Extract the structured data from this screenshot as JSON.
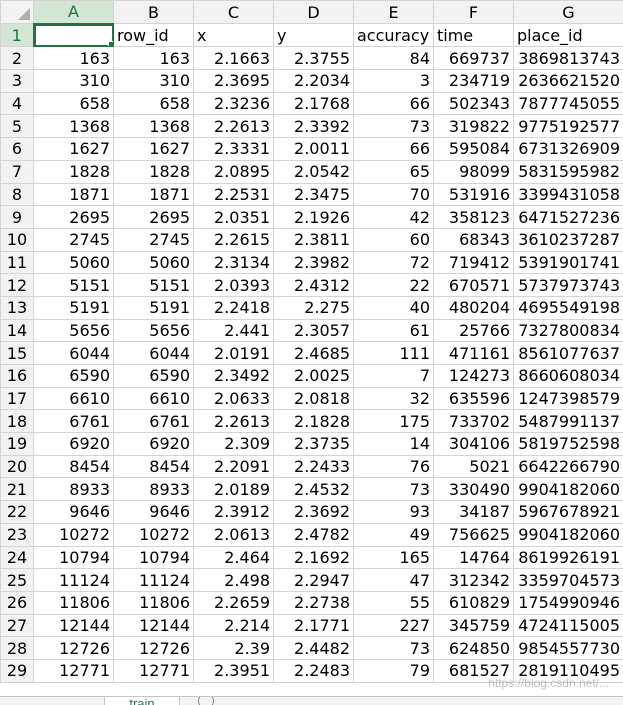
{
  "grid": {
    "columns": [
      "A",
      "B",
      "C",
      "D",
      "E",
      "F",
      "G"
    ],
    "active_column": "A",
    "active_row": "1",
    "headers_row": {
      "row_label": "1",
      "cells": [
        "",
        "row_id",
        "x",
        "y",
        "accuracy",
        "time",
        "place_id"
      ]
    },
    "rows": [
      {
        "label": "2",
        "cells": [
          "163",
          "163",
          "2.1663",
          "2.3755",
          "84",
          "669737",
          "3869813743"
        ]
      },
      {
        "label": "3",
        "cells": [
          "310",
          "310",
          "2.3695",
          "2.2034",
          "3",
          "234719",
          "2636621520"
        ]
      },
      {
        "label": "4",
        "cells": [
          "658",
          "658",
          "2.3236",
          "2.1768",
          "66",
          "502343",
          "7877745055"
        ]
      },
      {
        "label": "5",
        "cells": [
          "1368",
          "1368",
          "2.2613",
          "2.3392",
          "73",
          "319822",
          "9775192577"
        ]
      },
      {
        "label": "6",
        "cells": [
          "1627",
          "1627",
          "2.3331",
          "2.0011",
          "66",
          "595084",
          "6731326909"
        ]
      },
      {
        "label": "7",
        "cells": [
          "1828",
          "1828",
          "2.0895",
          "2.0542",
          "65",
          "98099",
          "5831595982"
        ]
      },
      {
        "label": "8",
        "cells": [
          "1871",
          "1871",
          "2.2531",
          "2.3475",
          "70",
          "531916",
          "3399431058"
        ]
      },
      {
        "label": "9",
        "cells": [
          "2695",
          "2695",
          "2.0351",
          "2.1926",
          "42",
          "358123",
          "6471527236"
        ]
      },
      {
        "label": "10",
        "cells": [
          "2745",
          "2745",
          "2.2615",
          "2.3811",
          "60",
          "68343",
          "3610237287"
        ]
      },
      {
        "label": "11",
        "cells": [
          "5060",
          "5060",
          "2.3134",
          "2.3982",
          "72",
          "719412",
          "5391901741"
        ]
      },
      {
        "label": "12",
        "cells": [
          "5151",
          "5151",
          "2.0393",
          "2.4312",
          "22",
          "670571",
          "5737973743"
        ]
      },
      {
        "label": "13",
        "cells": [
          "5191",
          "5191",
          "2.2418",
          "2.275",
          "40",
          "480204",
          "4695549198"
        ]
      },
      {
        "label": "14",
        "cells": [
          "5656",
          "5656",
          "2.441",
          "2.3057",
          "61",
          "25766",
          "7327800834"
        ]
      },
      {
        "label": "15",
        "cells": [
          "6044",
          "6044",
          "2.0191",
          "2.4685",
          "111",
          "471161",
          "8561077637"
        ]
      },
      {
        "label": "16",
        "cells": [
          "6590",
          "6590",
          "2.3492",
          "2.0025",
          "7",
          "124273",
          "8660608034"
        ]
      },
      {
        "label": "17",
        "cells": [
          "6610",
          "6610",
          "2.0633",
          "2.0818",
          "32",
          "635596",
          "1247398579"
        ]
      },
      {
        "label": "18",
        "cells": [
          "6761",
          "6761",
          "2.2613",
          "2.1828",
          "175",
          "733702",
          "5487991137"
        ]
      },
      {
        "label": "19",
        "cells": [
          "6920",
          "6920",
          "2.309",
          "2.3735",
          "14",
          "304106",
          "5819752598"
        ]
      },
      {
        "label": "20",
        "cells": [
          "8454",
          "8454",
          "2.2091",
          "2.2433",
          "76",
          "5021",
          "6642266790"
        ]
      },
      {
        "label": "21",
        "cells": [
          "8933",
          "8933",
          "2.0189",
          "2.4532",
          "73",
          "330490",
          "9904182060"
        ]
      },
      {
        "label": "22",
        "cells": [
          "9646",
          "9646",
          "2.3912",
          "2.3692",
          "93",
          "34187",
          "5967678921"
        ]
      },
      {
        "label": "23",
        "cells": [
          "10272",
          "10272",
          "2.0613",
          "2.4782",
          "49",
          "756625",
          "9904182060"
        ]
      },
      {
        "label": "24",
        "cells": [
          "10794",
          "10794",
          "2.464",
          "2.1692",
          "165",
          "14764",
          "8619926191"
        ]
      },
      {
        "label": "25",
        "cells": [
          "11124",
          "11124",
          "2.498",
          "2.2947",
          "47",
          "312342",
          "3359704573"
        ]
      },
      {
        "label": "26",
        "cells": [
          "11806",
          "11806",
          "2.2659",
          "2.2738",
          "55",
          "610829",
          "1754990946"
        ]
      },
      {
        "label": "27",
        "cells": [
          "12144",
          "12144",
          "2.214",
          "2.1771",
          "227",
          "345759",
          "4724115005"
        ]
      },
      {
        "label": "28",
        "cells": [
          "12726",
          "12726",
          "2.39",
          "2.4482",
          "73",
          "624850",
          "9854557730"
        ]
      },
      {
        "label": "29",
        "cells": [
          "12771",
          "12771",
          "2.3951",
          "2.2483",
          "79",
          "681527",
          "2819110495"
        ]
      }
    ]
  },
  "sheet_tabs": {
    "active_tab": "train",
    "add_sheet_icon": "plus-circle-icon"
  },
  "watermark": "https://blog.csdn.net/...",
  "colors": {
    "accent": "#217346",
    "header_bg": "#f2f2f2",
    "gridline": "#d4d4d4"
  }
}
